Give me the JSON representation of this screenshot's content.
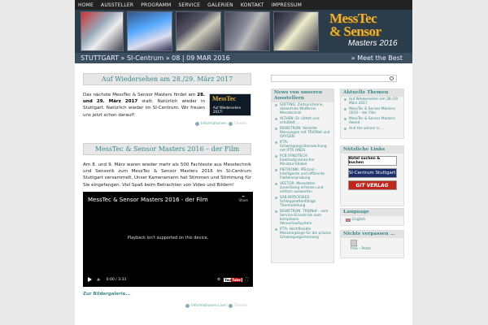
{
  "nav": [
    "HOME",
    "AUSSTELLER",
    "PROGRAMM",
    "SERVICE",
    "GALERIEN",
    "KONTAKT",
    "IMPRESSUM"
  ],
  "header": {
    "logo_line1": "MessTec",
    "logo_line2": "& Sensor",
    "logo_sub": "Masters 2016"
  },
  "locbar": {
    "location": "STUTTGART » SI-Centrum » 08 | 09 MAR 2016",
    "tagline": "» Meet the Best"
  },
  "post1": {
    "title": "Auf Wiedersehen am 28./29. März 2017",
    "body_pre": "Das nächste MessTec & Sensor Masters findet am ",
    "body_bold": "28. und 29. März 2017",
    "body_post": " statt. Natürlich wieder in Stuttgart. Natürlich wieder im SI-Centrum. Wir freuen uns jetzt schon darauf!",
    "image_text1": "MessTec",
    "image_text2": "Auf Wiedersehen 2017!",
    "footer_link": "Informationen",
    "footer_comment": "Closed"
  },
  "post2": {
    "title": "MessTec & Sensor Masters 2016 – der Film",
    "body": "Am 8. und 9. März waren wieder mehr als 500 Fachleute aus Messtechnik und Sensorik zum MessTec & Sensor Masters 2016 im SI-Centrum Stuttgart versammelt. Unser Kameramann hat Stimmen und Stimmung für Sie eingefangen. Viel Spaß beim Betrachten von Video und Bildern!",
    "video_title": "MessTec & Sensor Masters 2016 - der Film",
    "video_share": "Share",
    "video_msg": "Playback isn't supported on this device.",
    "video_time": "0:00 / 3:33",
    "yt_you": "You",
    "yt_tube": "Tube",
    "gallery_link": "Zur Bildergalerie...",
    "footer_link": "Informationen Live!",
    "footer_comment": "Closed"
  },
  "sidebar": {
    "news": {
      "title": "News von unseren Ausstellern",
      "items": [
        {
          "link": "SOFTING: Zeitsynchrone, dezentrale Weltkreis-Messtechnik",
          "sub": ""
        },
        {
          "link": "ALTHEN: Es rüttelt und schüttelt ...",
          "sub": ""
        },
        {
          "link": "DEWETRON: Verteilte Messungen mit TRIONet und OXYGEN",
          "sub": ""
        },
        {
          "link": "IFTA: Schwingungsüberwachung mit IFTA ONDS",
          "sub": ""
        },
        {
          "link": "PCB SYNOTECH: Elektrodynamischer Miniatur-Shaker",
          "sub": ""
        },
        {
          "link": "PIETRONIK: IPE/cool - Intelligente und effiziente Flottenerprobung",
          "sub": ""
        },
        {
          "link": "VECTOR: Messdaten zuverlässig erfassen und einfach auswerten",
          "sub": ""
        },
        {
          "link": "SAB BRÖCKSKES: Schleppkettenfähige Thermoleitung",
          "sub": ""
        },
        {
          "link": "DEWETRON: TRIONet - vom Service-Einsatz bis zum komplexen Versuchaufsystem",
          "sub": ""
        },
        {
          "link": "IFTA: Hochflexible Messeingänge für die präzise Schwingungsmessung",
          "sub": ""
        }
      ]
    },
    "topics": {
      "title": "Aktuelle Themen",
      "items": [
        "Auf Wiedersehen am 28./29. März 2017",
        "MessTec & Sensor Masters 2016 – der Film",
        "MessTec & Sensor Masters Award",
        "And the winner is ..."
      ]
    },
    "links": {
      "title": "Nützliche Links",
      "items": [
        "Hotel suchen & buchen",
        "SI-Centrum Stuttgart",
        "GIT VERLAG"
      ]
    },
    "language": {
      "title": "Language",
      "item": "English"
    },
    "rss": {
      "title": "Nichts verpassen ...",
      "item": "RSS - Posts"
    }
  }
}
